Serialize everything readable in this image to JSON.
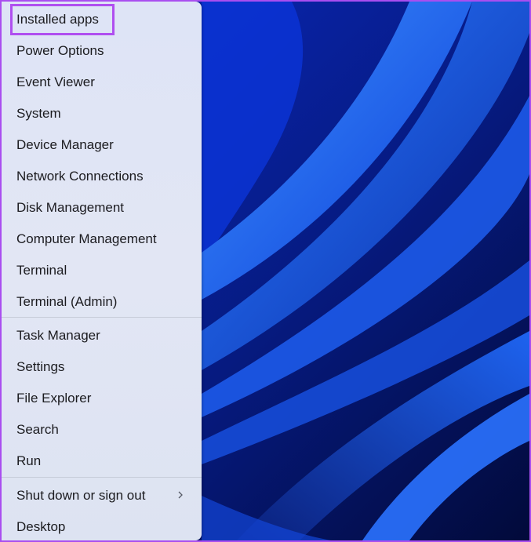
{
  "menu": {
    "groups": [
      {
        "items": [
          {
            "label": "Installed apps",
            "highlighted": true
          },
          {
            "label": "Power Options"
          },
          {
            "label": "Event Viewer"
          },
          {
            "label": "System"
          },
          {
            "label": "Device Manager"
          },
          {
            "label": "Network Connections"
          },
          {
            "label": "Disk Management"
          },
          {
            "label": "Computer Management"
          },
          {
            "label": "Terminal"
          },
          {
            "label": "Terminal (Admin)"
          }
        ]
      },
      {
        "items": [
          {
            "label": "Task Manager"
          },
          {
            "label": "Settings"
          },
          {
            "label": "File Explorer"
          },
          {
            "label": "Search"
          },
          {
            "label": "Run"
          }
        ]
      },
      {
        "items": [
          {
            "label": "Shut down or sign out",
            "submenu_icon": "chevron-right-icon"
          },
          {
            "label": "Desktop"
          }
        ]
      }
    ]
  },
  "colors": {
    "highlight_border": "#b04ff0",
    "outer_border": "#a94ef0",
    "menu_text": "#1b1b1f",
    "wallpaper_base": "#0a2bb8",
    "wallpaper_accent": "#2f7cff"
  }
}
